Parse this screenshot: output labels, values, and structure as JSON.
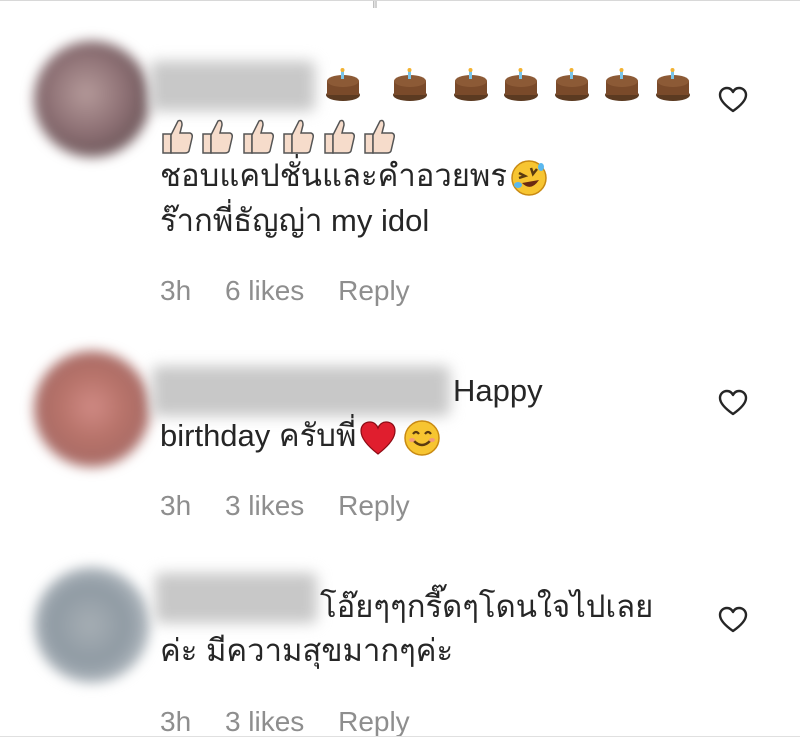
{
  "colors": {
    "text": "#262626",
    "meta": "#8e8e8e",
    "heart_outline": "#262626"
  },
  "comments": [
    {
      "line1": "ชอบแคปชั่นและคำอวยพร",
      "line2": "ร๊ากพี่ธัญญ่า my idol",
      "emoji_row1": "birthday-cake-icon x7",
      "emoji_row2": "thumbs-up-icon x6",
      "time": "3h",
      "likes": "6 likes",
      "reply": "Reply"
    },
    {
      "line1": "Happy",
      "line2": "birthday ครับพี่",
      "time": "3h",
      "likes": "3 likes",
      "reply": "Reply"
    },
    {
      "line1": "โอ๊ยๆๆกรี๊ดๆโดนใจไปเลย",
      "line2": "ค่ะ มีความสุขมากๆค่ะ",
      "time": "3h",
      "likes": "3 likes",
      "reply": "Reply"
    }
  ]
}
